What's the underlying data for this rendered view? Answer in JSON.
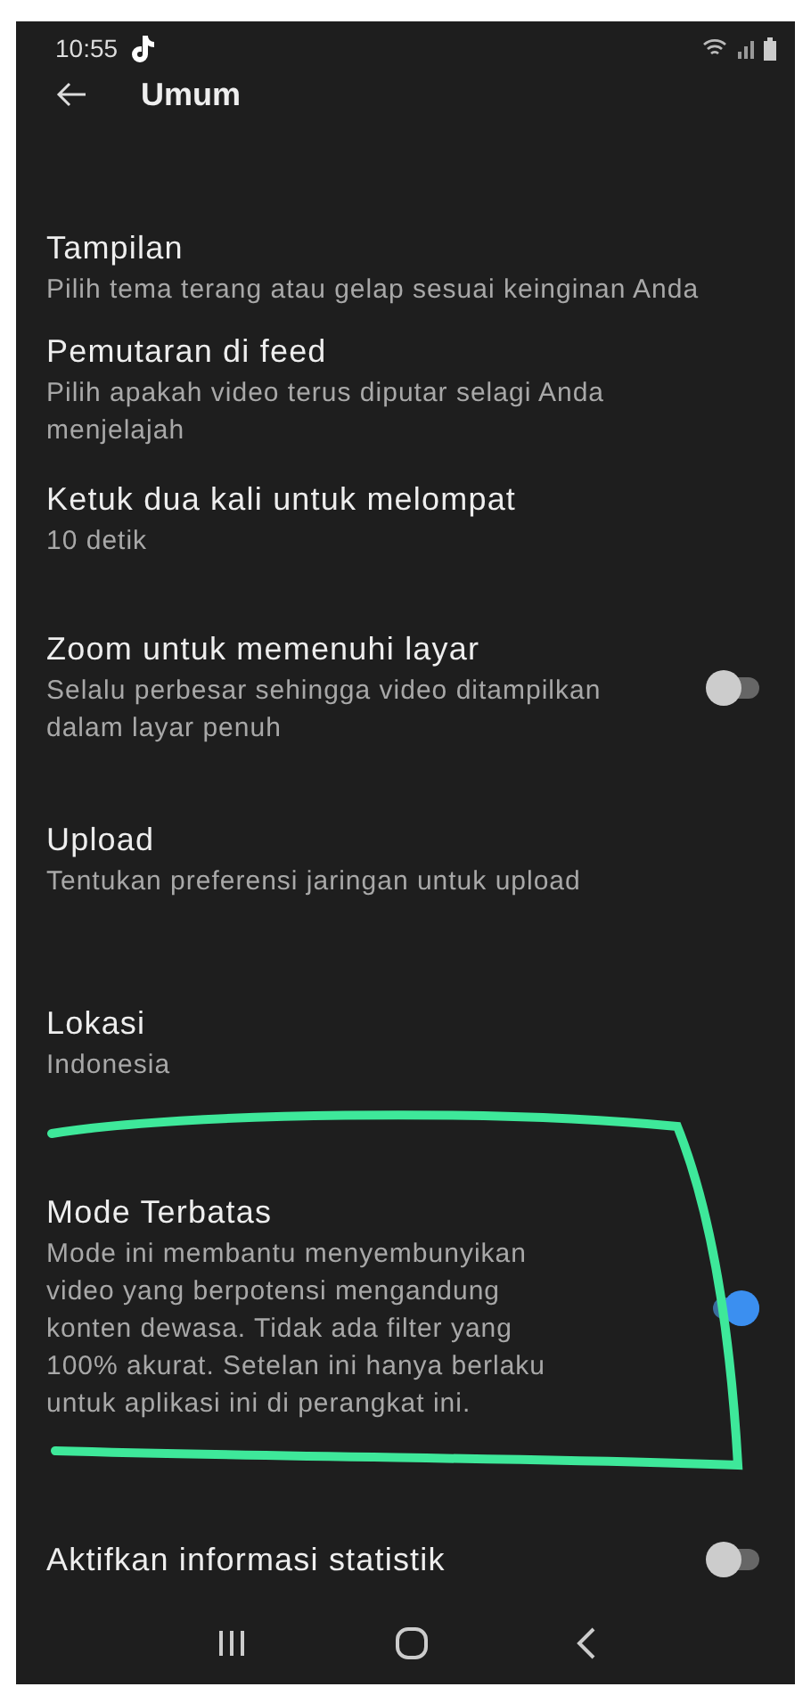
{
  "status_bar": {
    "time": "10:55"
  },
  "header": {
    "title": "Umum"
  },
  "settings": [
    {
      "kind": "text",
      "title": "Tampilan",
      "subtitle": "Pilih tema terang atau gelap sesuai keinginan Anda"
    },
    {
      "kind": "text",
      "title": "Pemutaran di feed",
      "subtitle": "Pilih apakah video terus diputar selagi Anda menjelajah"
    },
    {
      "kind": "text",
      "title": "Ketuk dua kali untuk melompat",
      "subtitle": "10 detik"
    },
    {
      "kind": "toggle",
      "title": "Zoom untuk memenuhi layar",
      "subtitle": "Selalu perbesar sehingga video ditampilkan dalam layar penuh",
      "on": false
    },
    {
      "kind": "text",
      "title": "Upload",
      "subtitle": "Tentukan preferensi jaringan untuk upload"
    },
    {
      "kind": "text",
      "title": "Lokasi",
      "subtitle": "Indonesia"
    },
    {
      "kind": "toggle",
      "title": "Mode Terbatas",
      "subtitle": "Mode ini membantu menyembunyikan video yang berpotensi mengandung konten dewasa. Tidak ada filter yang 100% akurat. Setelan ini hanya berlaku untuk aplikasi ini di perangkat ini.",
      "on": true
    },
    {
      "kind": "toggle",
      "title": "Aktifkan informasi statistik",
      "on": false
    }
  ]
}
